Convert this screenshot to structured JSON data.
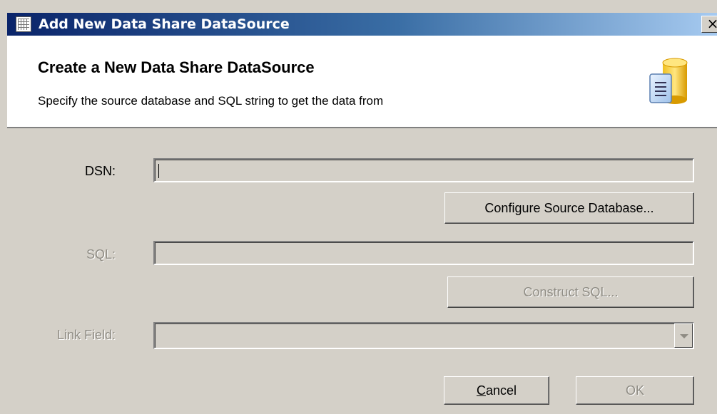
{
  "window": {
    "title": "Add New Data Share DataSource",
    "close_label": "×"
  },
  "header": {
    "title": "Create a New Data Share DataSource",
    "subtitle": "Specify the source database and SQL string to get the data from",
    "icon": "database-icon"
  },
  "form": {
    "dsn": {
      "label": "DSN:",
      "value": ""
    },
    "configure_button": "Configure Source Database...",
    "sql": {
      "label": "SQL:",
      "value": ""
    },
    "construct_button": "Construct SQL...",
    "link_field": {
      "label": "Link Field:",
      "value": ""
    }
  },
  "buttons": {
    "cancel_prefix": "C",
    "cancel_rest": "ancel",
    "ok": "OK"
  }
}
